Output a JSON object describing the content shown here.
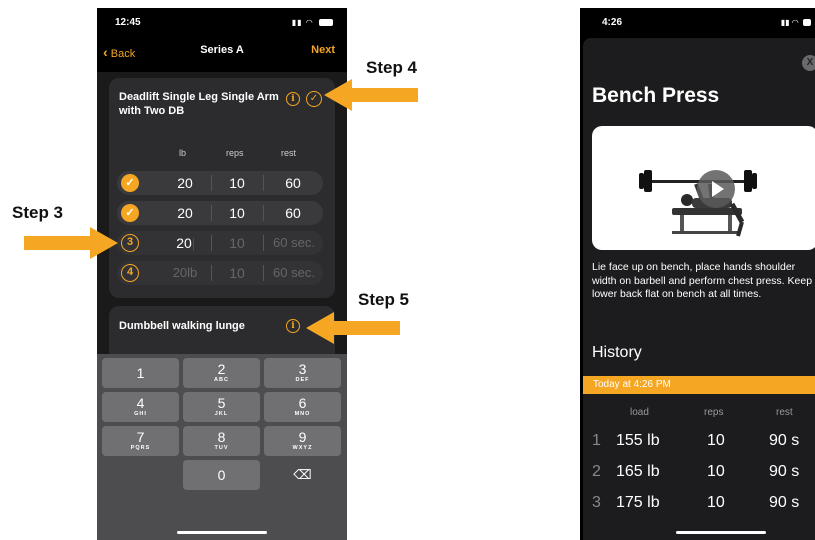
{
  "left_phone": {
    "status": {
      "time": "12:45"
    },
    "nav": {
      "back": "Back",
      "title": "Series A",
      "next": "Next"
    },
    "exercise1": {
      "name": "Deadlift Single Leg Single Arm with Two DB",
      "columns": {
        "weight": "lb",
        "reps": "reps",
        "rest": "rest"
      },
      "sets": [
        {
          "badge": "✓",
          "weight": "20",
          "reps": "10",
          "rest": "60"
        },
        {
          "badge": "✓",
          "weight": "20",
          "reps": "10",
          "rest": "60"
        },
        {
          "badge": "3",
          "weight": "20",
          "reps": "10",
          "rest": "60 sec."
        },
        {
          "badge": "4",
          "weight": "20lb",
          "reps": "10",
          "rest": "60 sec."
        }
      ]
    },
    "exercise2": {
      "name": "Dumbbell walking lunge"
    },
    "keypad": [
      {
        "num": "1",
        "letters": ""
      },
      {
        "num": "2",
        "letters": "ABC"
      },
      {
        "num": "3",
        "letters": "DEF"
      },
      {
        "num": "4",
        "letters": "GHI"
      },
      {
        "num": "5",
        "letters": "JKL"
      },
      {
        "num": "6",
        "letters": "MNO"
      },
      {
        "num": "7",
        "letters": "PQRS"
      },
      {
        "num": "8",
        "letters": "TUV"
      },
      {
        "num": "9",
        "letters": "WXYZ"
      },
      {
        "num": "0",
        "letters": ""
      },
      {
        "num": "⌫",
        "letters": ""
      }
    ]
  },
  "annotations": {
    "step3": "Step 3",
    "step4": "Step 4",
    "step5": "Step 5",
    "arrow_color": "#f5a623"
  },
  "right_phone": {
    "status": {
      "time": "4:26"
    },
    "close": "X",
    "title": "Bench Press",
    "description": "Lie face up on bench, place hands shoulder width on barbell and perform chest press. Keep lower back flat on bench at all times.",
    "history_title": "History",
    "today_label": "Today at 4:26 PM",
    "columns": {
      "load": "load",
      "reps": "reps",
      "rest": "rest"
    },
    "rows": [
      {
        "n": "1",
        "load": "155 lb",
        "reps": "10",
        "rest": "90 s"
      },
      {
        "n": "2",
        "load": "165 lb",
        "reps": "10",
        "rest": "90 s"
      },
      {
        "n": "3",
        "load": "175 lb",
        "reps": "10",
        "rest": "90 s"
      }
    ]
  },
  "colors": {
    "accent": "#f5a623",
    "card": "#2c2c2e",
    "background": "#000000"
  }
}
